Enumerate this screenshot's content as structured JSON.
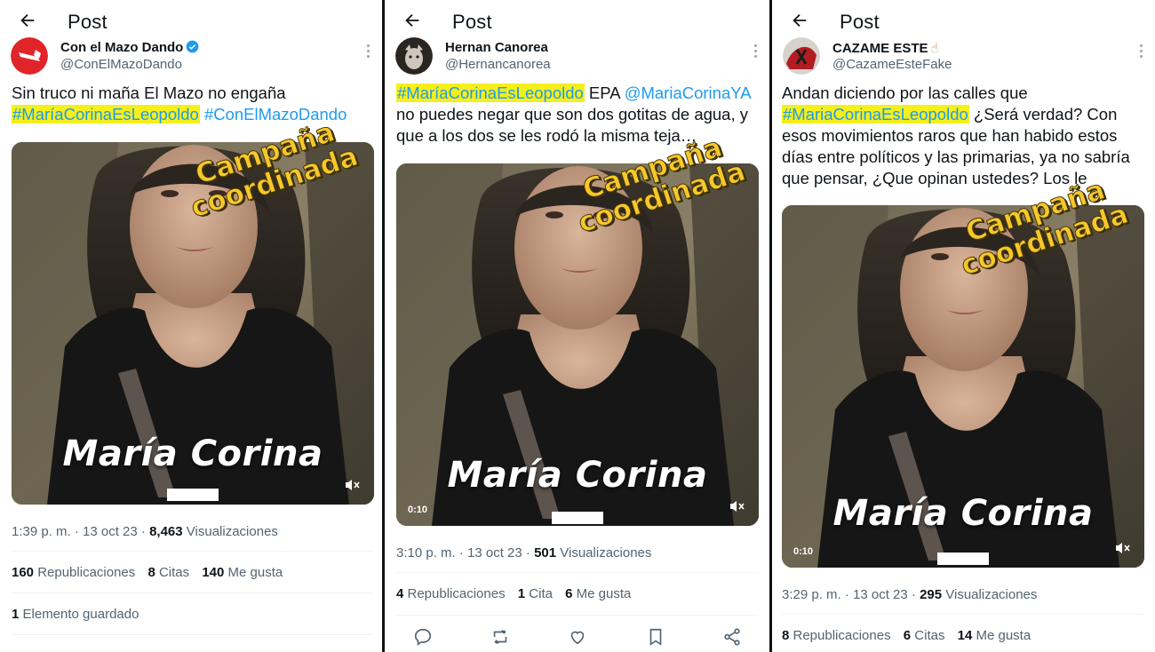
{
  "header_label": "Post",
  "stamp": {
    "line1": "Campaña",
    "line2": "coordinada"
  },
  "video_overlay_name": "María Corina",
  "posts": [
    {
      "author": {
        "name": "Con el Mazo Dando",
        "handle": "@ConElMazoDando",
        "verified": true
      },
      "text": {
        "line1": "Sin truco ni maña El Mazo no engaña",
        "hashtag1": "#MaríaCorinaEsLeopoldo",
        "hashtag2": "#ConElMazoDando"
      },
      "video_time": "",
      "meta": {
        "time": "1:39 p. m. · 13 oct 23 · ",
        "views": "8,463",
        "views_label": " Visualizaciones"
      },
      "stats": [
        {
          "count": "160",
          "label": " Republicaciones"
        },
        {
          "count": "8",
          "label": " Citas"
        },
        {
          "count": "140",
          "label": " Me gusta"
        }
      ],
      "saved": {
        "count": "1",
        "label": " Elemento guardado"
      }
    },
    {
      "author": {
        "name": "Hernan Canorea",
        "handle": "@Hernancanorea",
        "verified": false
      },
      "text": {
        "hashtag1": "#MaríaCorinaEsLeopoldo",
        "mid1": " EPA ",
        "mention": "@MariaCorinaYA",
        "line2": "no puedes negar que son dos gotitas de agua, y",
        "line3": "que a los dos se les rodó la misma teja…"
      },
      "video_time": "0:10",
      "meta": {
        "time": "3:10 p. m. · 13 oct 23 · ",
        "views": "501",
        "views_label": " Visualizaciones"
      },
      "stats": [
        {
          "count": "4",
          "label": " Republicaciones"
        },
        {
          "count": "1",
          "label": " Cita"
        },
        {
          "count": "6",
          "label": " Me gusta"
        }
      ],
      "actions": [
        "reply-icon",
        "repost-icon",
        "like-icon",
        "bookmark-icon",
        "share-icon"
      ]
    },
    {
      "author": {
        "name": "CAZAME ESTE",
        "emoji": "☝",
        "handle": "@CazameEsteFake",
        "verified": false
      },
      "text": {
        "line1": "Andan diciendo por las calles que",
        "hashtag1": "#MariaCorinaEsLeopoldo",
        "rest1": " ¿Será verdad? Con",
        "line3": "esos movimientos raros que han habido estos",
        "line4": "días entre políticos y las primarias, ya no sabría",
        "line5": "que pensar, ¿Que opinan ustedes? Los le"
      },
      "video_time": "0:10",
      "meta": {
        "time": "3:29 p. m. · 13 oct 23 · ",
        "views": "295",
        "views_label": " Visualizaciones"
      },
      "stats": [
        {
          "count": "8",
          "label": " Republicaciones"
        },
        {
          "count": "6",
          "label": " Citas"
        },
        {
          "count": "14",
          "label": " Me gusta"
        }
      ]
    }
  ]
}
